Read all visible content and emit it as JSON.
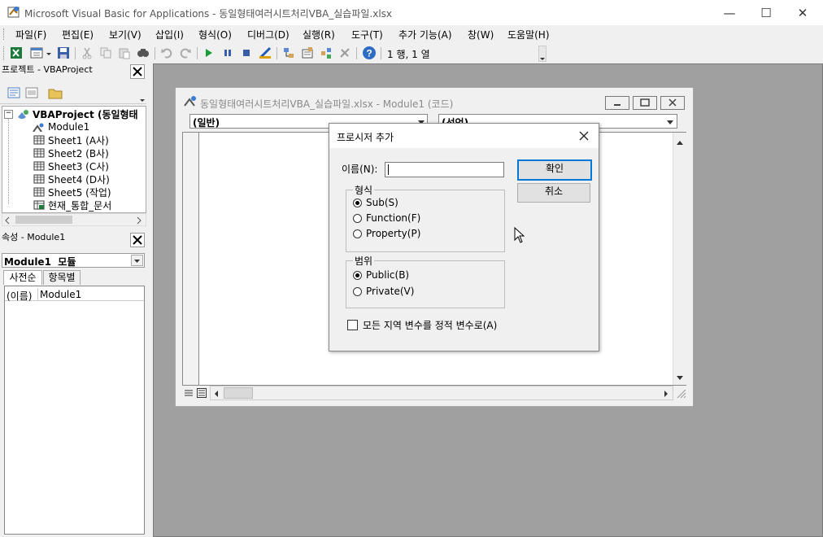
{
  "window": {
    "title": "Microsoft Visual Basic for Applications - 동일형태여러시트처리VBA_실습파일.xlsx",
    "minimize": "—",
    "maximize": "☐",
    "close": "✕"
  },
  "menu": [
    "파일(F)",
    "편집(E)",
    "보기(V)",
    "삽입(I)",
    "형식(O)",
    "디버그(D)",
    "실행(R)",
    "도구(T)",
    "추가 기능(A)",
    "창(W)",
    "도움말(H)"
  ],
  "toolbar": {
    "position": "1 행, 1 열"
  },
  "project": {
    "title": "프로젝트 - VBAProject",
    "root": "VBAProject (동일형태",
    "items": [
      "Module1",
      "Sheet1 (A사)",
      "Sheet2 (B사)",
      "Sheet3 (C사)",
      "Sheet4 (D사)",
      "Sheet5 (작업)",
      "현재_통합_문서"
    ]
  },
  "properties": {
    "title": "속성 - Module1",
    "object_select": "Module1  모듈",
    "tabs": [
      "사전순",
      "항목별"
    ],
    "row_name": "(이름)",
    "row_value": "Module1"
  },
  "code_window": {
    "title": "동일형태여러시트처리VBA_실습파일.xlsx - Module1 (코드)",
    "object_combo": "(일반)",
    "proc_combo": "(선언)"
  },
  "dialog": {
    "title": "프로시저 추가",
    "name_label": "이름(N):",
    "name_value": "",
    "ok": "확인",
    "cancel": "취소",
    "type_group": "형식",
    "type_options": [
      "Sub(S)",
      "Function(F)",
      "Property(P)"
    ],
    "scope_group": "범위",
    "scope_options": [
      "Public(B)",
      "Private(V)"
    ],
    "static_checkbox": "모든 지역 변수를 정적 변수로(A)",
    "selected_type": "Sub(S)",
    "selected_scope": "Public(B)"
  },
  "colors": {
    "accent": "#0066cc",
    "titlebar": "#ffffff",
    "mdi_bg": "#a0a0a0"
  }
}
